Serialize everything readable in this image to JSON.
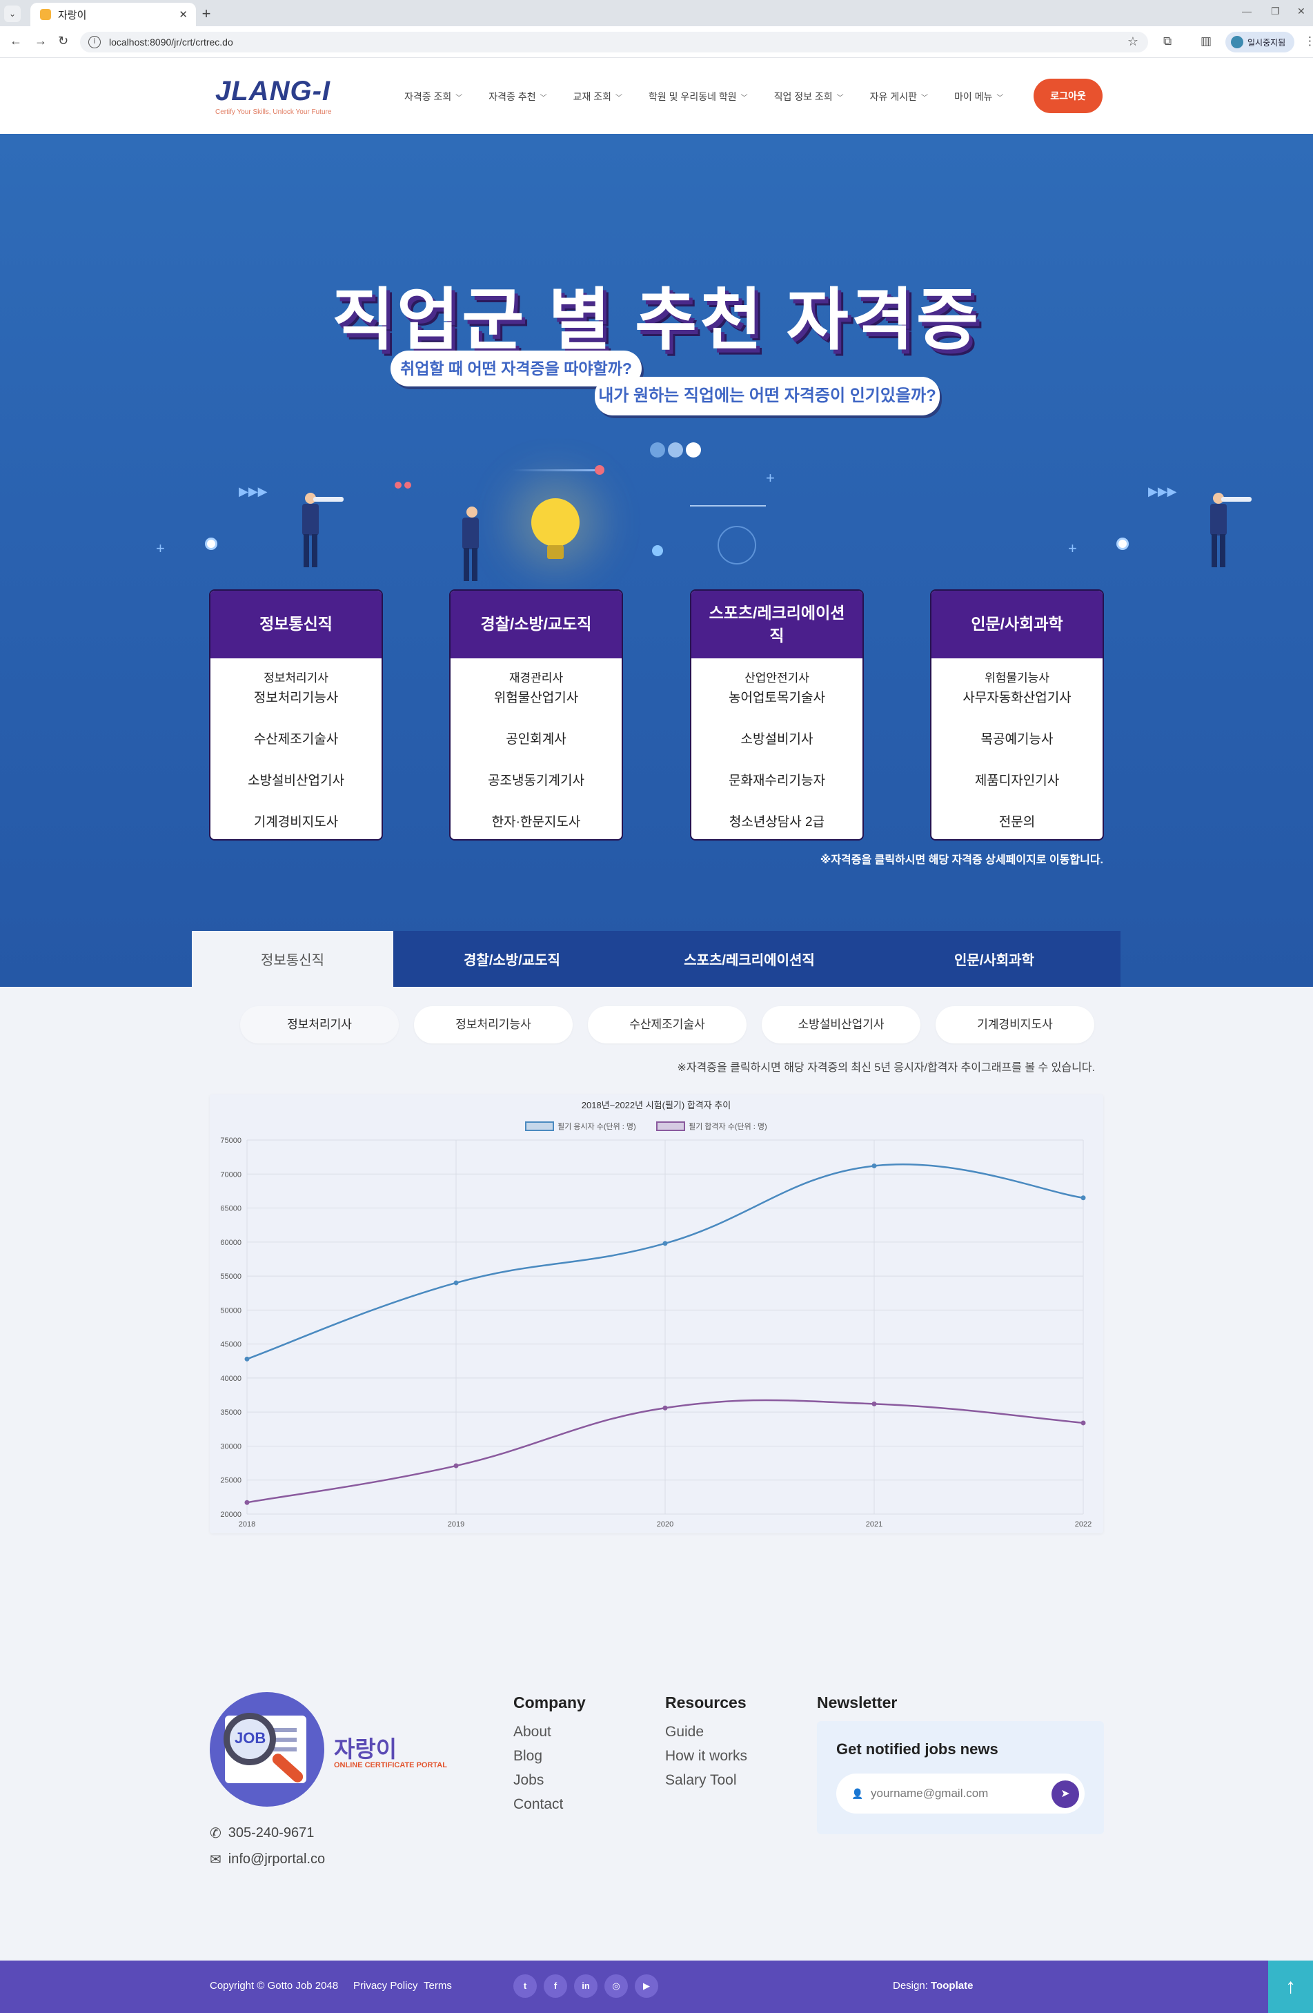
{
  "browser": {
    "tab_title": "자랑이",
    "url": "localhost:8090/jr/crt/crtrec.do",
    "profile_label": "일시중지됨"
  },
  "header": {
    "logo_text": "JLANG-I",
    "logo_tagline": "Certify Your Skills, Unlock Your Future",
    "menu": [
      "자격증 조회",
      "자격증 추천",
      "교재 조회",
      "학원 및 우리동네 학원",
      "직업 정보 조회",
      "자유 게시판",
      "마이 메뉴"
    ],
    "logout_label": "로그아웃"
  },
  "hero": {
    "title": "직업군 별 추천 자격증",
    "bubble1": "취업할 때 어떤 자격증을 따야할까?",
    "bubble2": "내가 원하는 직업에는 어떤 자격증이 인기있을까?",
    "hint": "※자격증을 클릭하시면 해당 자격증 상세페이지로 이동합니다."
  },
  "cards": [
    {
      "title": "정보통신직",
      "items": [
        "정보처리기사",
        "정보처리기능사",
        "수산제조기술사",
        "소방설비산업기사",
        "기계경비지도사"
      ]
    },
    {
      "title": "경찰/소방/교도직",
      "items": [
        "재경관리사",
        "위험물산업기사",
        "공인회계사",
        "공조냉동기계기사",
        "한자·한문지도사"
      ]
    },
    {
      "title": "스포츠/레크리에이션직",
      "items": [
        "산업안전기사",
        "농어업토목기술사",
        "소방설비기사",
        "문화재수리기능자",
        "청소년상담사 2급"
      ]
    },
    {
      "title": "인문/사회과학",
      "items": [
        "위험물기능사",
        "사무자동화산업기사",
        "목공예기능사",
        "제품디자인기사",
        "전문의"
      ]
    }
  ],
  "tabs": [
    "정보통신직",
    "경찰/소방/교도직",
    "스포츠/레크리에이션직",
    "인문/사회과학"
  ],
  "cert_pills": [
    "정보처리기사",
    "정보처리기능사",
    "수산제조기술사",
    "소방설비산업기사",
    "기계경비지도사"
  ],
  "chart_hint": "※자격증을 클릭하시면 해당 자격증의 최신 5년 응시자/합격자 추이그래프를 볼 수 있습니다.",
  "chart_data": {
    "type": "line",
    "title": "2018년~2022년 시험(필기) 합격자 추이",
    "x": [
      "2018",
      "2019",
      "2020",
      "2021",
      "2022"
    ],
    "ylim": [
      20000,
      75000
    ],
    "yticks": [
      "75000",
      "70000",
      "65000",
      "60000",
      "55000",
      "50000",
      "45000",
      "40000",
      "35000",
      "30000",
      "25000",
      "20000"
    ],
    "grid": true,
    "legend_position": "top",
    "series": [
      {
        "name": "필기 응시자 수(단위 : 명)",
        "values": [
          42800,
          54000,
          59800,
          71200,
          66500
        ],
        "color": "#4a8ac0"
      },
      {
        "name": "필기 합격자 수(단위 : 명)",
        "values": [
          21700,
          27100,
          35600,
          36200,
          33400
        ],
        "color": "#8a5a9e"
      }
    ]
  },
  "footer": {
    "brand_name": "자랑이",
    "brand_sub": "ONLINE CERTIFICATE PORTAL",
    "logo_badge": "JOB",
    "phone": "305-240-9671",
    "email": "info@jrportal.co",
    "company_heading": "Company",
    "company_links": [
      "About",
      "Blog",
      "Jobs",
      "Contact"
    ],
    "resources_heading": "Resources",
    "resources_links": [
      "Guide",
      "How it works",
      "Salary Tool"
    ],
    "newsletter_heading": "Newsletter",
    "newsletter_title": "Get notified jobs news",
    "newsletter_placeholder": "yourname@gmail.com",
    "copyright": "Copyright © Gotto Job 2048",
    "privacy": "Privacy Policy",
    "terms": "Terms",
    "design_label": "Design:",
    "design_by": "Tooplate"
  }
}
